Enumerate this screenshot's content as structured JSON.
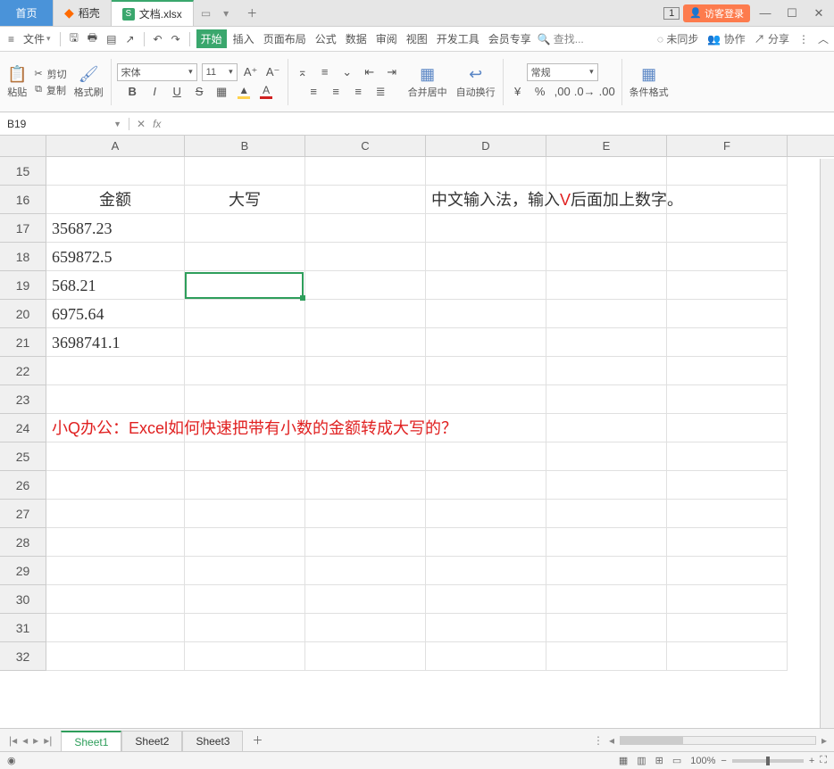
{
  "tabs": {
    "home": "首页",
    "daoke": "稻壳",
    "doc": "文档.xlsx"
  },
  "win": {
    "badge": "1",
    "login": "访客登录"
  },
  "menu": {
    "hamburger": "≡",
    "file": "文件",
    "items": [
      "开始",
      "插入",
      "页面布局",
      "公式",
      "数据",
      "审阅",
      "视图",
      "开发工具",
      "会员专享"
    ],
    "search": "查找...",
    "unsync": "未同步",
    "collab": "协作",
    "share": "分享"
  },
  "ribbon": {
    "paste": "粘贴",
    "cut": "剪切",
    "copy": "复制",
    "format_painter": "格式刷",
    "font_name": "宋体",
    "font_size": "11",
    "merge": "合并居中",
    "wrap": "自动换行",
    "number_format": "常规",
    "cond_format": "条件格式"
  },
  "namebox": "B19",
  "grid": {
    "cols": [
      "A",
      "B",
      "C",
      "D",
      "E",
      "F"
    ],
    "row_start": 15,
    "row_end": 32,
    "rows": {
      "16": {
        "A": "金额",
        "B": "大写",
        "D_text_pre": "中文输入法，输入",
        "D_text_v": "V",
        "D_text_post": "后面加上数字。"
      },
      "17": {
        "A": "35687.23"
      },
      "18": {
        "A": "659872.5"
      },
      "19": {
        "A": "568.21"
      },
      "20": {
        "A": "6975.64"
      },
      "21": {
        "A": "3698741.1"
      },
      "24": {
        "A_red": "小Q办公：Excel如何快速把带有小数的金额转成大写的？"
      }
    },
    "cursor_cell": "B19"
  },
  "sheets": {
    "tabs": [
      "Sheet1",
      "Sheet2",
      "Sheet3"
    ],
    "active": 0
  },
  "status": {
    "zoom": "100%"
  }
}
